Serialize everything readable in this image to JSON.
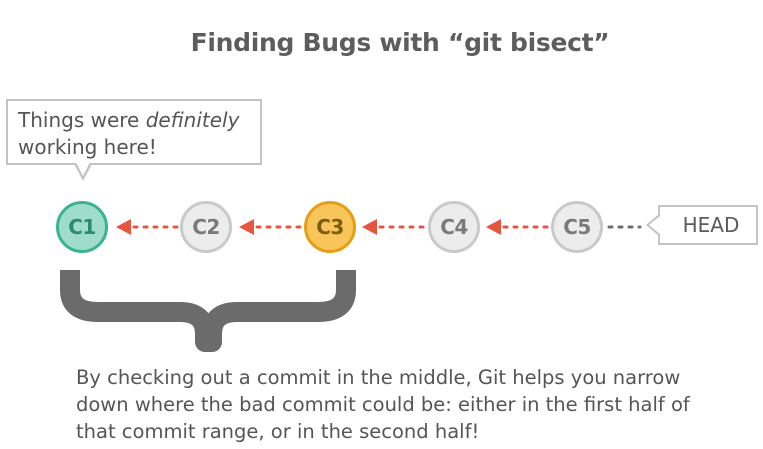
{
  "title": "Finding Bugs with “git bisect”",
  "callout": {
    "text_before": "Things were ",
    "text_emphasis": "definitely",
    "text_after": " working here!"
  },
  "commits": [
    {
      "label": "C1",
      "state": "good",
      "color": "#3ab393"
    },
    {
      "label": "C2",
      "state": "neutral",
      "color": "#c9c9c9"
    },
    {
      "label": "C3",
      "state": "middle",
      "color": "#e59e16"
    },
    {
      "label": "C4",
      "state": "neutral",
      "color": "#c9c9c9"
    },
    {
      "label": "C5",
      "state": "neutral",
      "color": "#c9c9c9"
    }
  ],
  "head_label": "HEAD",
  "caption": "By checking out a commit in the middle, Git helps you narrow down where the bad commit could be: either in the first half of that commit range, or in the second half!",
  "colors": {
    "arrow": "#e8553f",
    "brace": "#6b6b6b",
    "dots": "#6b6b6b"
  }
}
